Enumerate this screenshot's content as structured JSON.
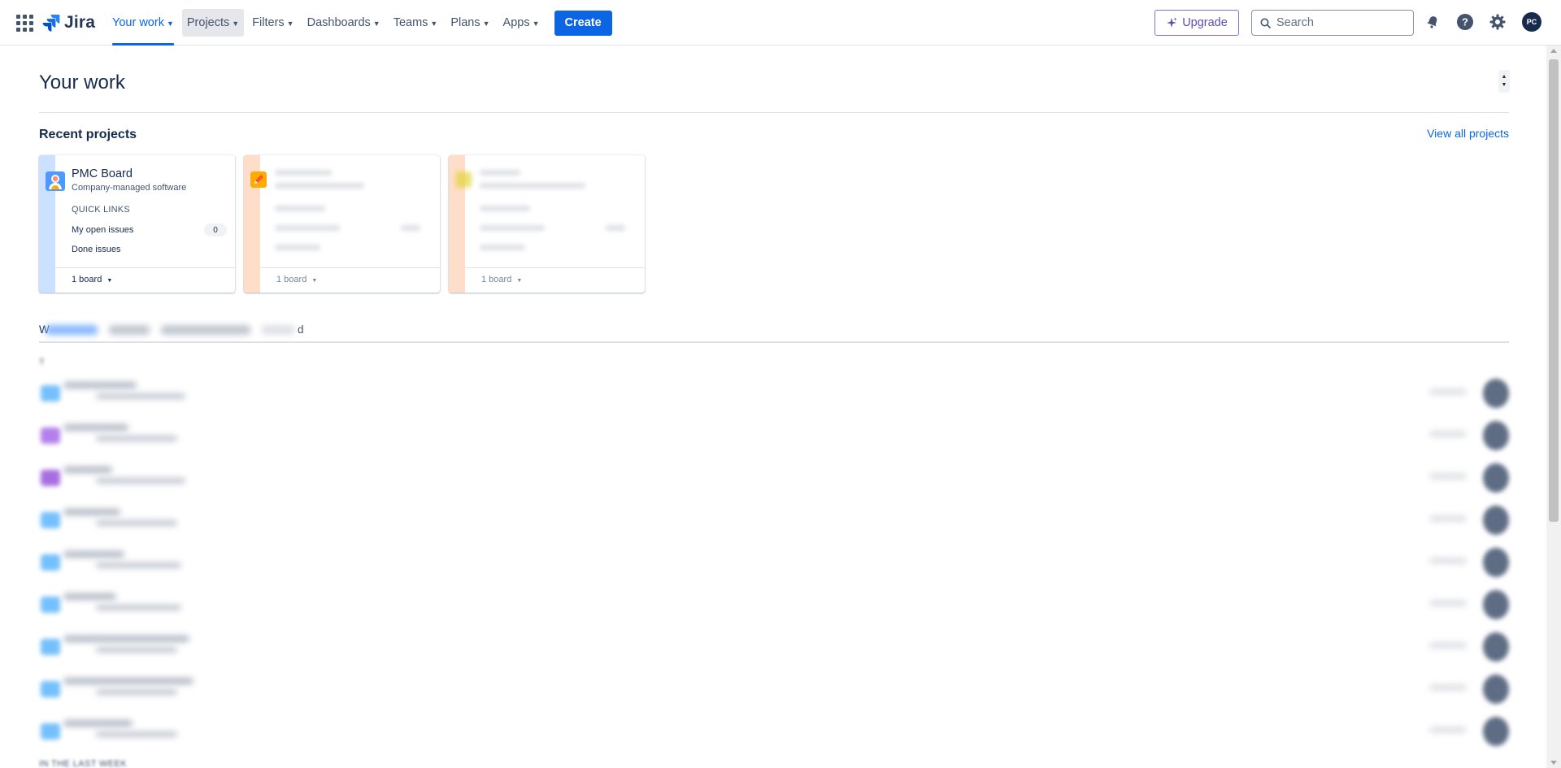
{
  "nav": {
    "logo": "Jira",
    "items": [
      {
        "label": "Your work",
        "state": "active"
      },
      {
        "label": "Projects",
        "state": "hover"
      },
      {
        "label": "Filters",
        "state": ""
      },
      {
        "label": "Dashboards",
        "state": ""
      },
      {
        "label": "Teams",
        "state": ""
      },
      {
        "label": "Plans",
        "state": ""
      },
      {
        "label": "Apps",
        "state": ""
      }
    ],
    "create_label": "Create",
    "upgrade_label": "Upgrade",
    "search_placeholder": "Search",
    "avatar_initials": "PC",
    "icons": [
      "app-switcher-icon",
      "notifications-icon",
      "help-icon",
      "settings-icon"
    ]
  },
  "page": {
    "title": "Your work",
    "recent_projects_title": "Recent projects",
    "view_all_label": "View all projects",
    "tab_first_glyph": "W",
    "tab_last_glyph": "d",
    "today_label": "T",
    "last_week_label": "IN THE LAST WEEK"
  },
  "projects": [
    {
      "name": "PMC Board",
      "type": "Company-managed software",
      "quick_links_label": "QUICK LINKS",
      "open_issues_label": "My open issues",
      "open_issues_count": "0",
      "done_issues_label": "Done issues",
      "boards_label": "1 board",
      "stripe_color": "#cce0ff"
    },
    {
      "boards_label": "1 board",
      "stripe_color": "#fedec8"
    },
    {
      "boards_label": "1 board",
      "stripe_color": "#fedec8"
    }
  ],
  "colors": {
    "brand": "#0c66e4",
    "upgrade": "#5e4db2",
    "text": "#172b4d",
    "subtle": "#44546f"
  }
}
